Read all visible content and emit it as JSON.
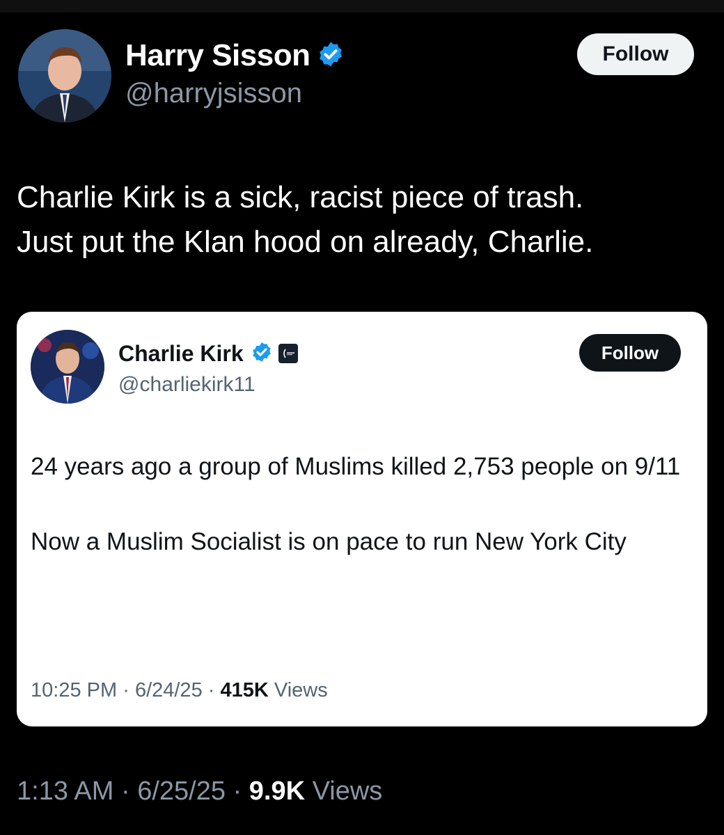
{
  "tweet": {
    "author": {
      "name": "Harry Sisson",
      "handle": "@harryjsisson",
      "verified": true
    },
    "follow_label": "Follow",
    "text": "Charlie Kirk is a sick, racist piece of trash.\nJust put the Klan hood on already, Charlie.",
    "time": "1:13 AM",
    "date": "6/25/25",
    "separator": "·",
    "views_count": "9.9K",
    "views_label": "Views"
  },
  "quoted": {
    "author": {
      "name": "Charlie Kirk",
      "handle": "@charliekirk11",
      "verified": true,
      "affiliation_icon": "organization-badge-icon"
    },
    "follow_label": "Follow",
    "paragraphs": [
      "24 years ago a group of Muslims killed 2,753 people on 9/11",
      "Now a Muslim Socialist is on pace to run New York City"
    ],
    "time": "10:25 PM",
    "date": "6/24/25",
    "separator": "·",
    "views_count": "415K",
    "views_label": "Views"
  },
  "colors": {
    "background": "#000000",
    "verified_blue": "#1d9bf0",
    "secondary_text_dark": "#8b98a5",
    "secondary_text_light": "#536471"
  }
}
